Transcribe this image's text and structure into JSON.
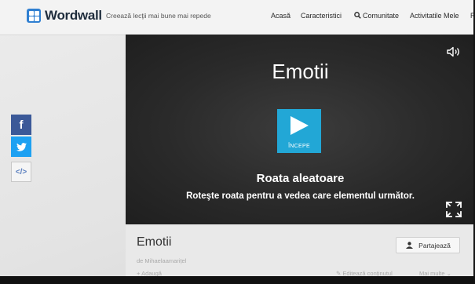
{
  "header": {
    "brand": "Wordwall",
    "tagline": "Creează lecţii mai bune mai repede",
    "nav": [
      "Acasă",
      "Caracteristici",
      "Comunitate",
      "Activitatile Mele",
      "R"
    ]
  },
  "share_rail": {
    "facebook": "f",
    "embed": "</>"
  },
  "player": {
    "title": "Emotii",
    "start_label": "ÎNCEPE",
    "template_name": "Roata aleatoare",
    "template_desc": "Roteşte roata pentru a vedea care elementul următor.",
    "icons": [
      "speaker-icon",
      "play-icon",
      "fullscreen-icon"
    ]
  },
  "info": {
    "title": "Emotii",
    "share_label": "Partajează",
    "author": "de Mihaelaamarițel",
    "add_label": "Adaugă",
    "edit_label": "Editează conţinutul",
    "more_label": "Mai multe"
  },
  "colors": {
    "accent": "#22a7d6",
    "facebook": "#3b5998",
    "twitter": "#1da1f2",
    "player_bg": "#2a2a2a"
  }
}
